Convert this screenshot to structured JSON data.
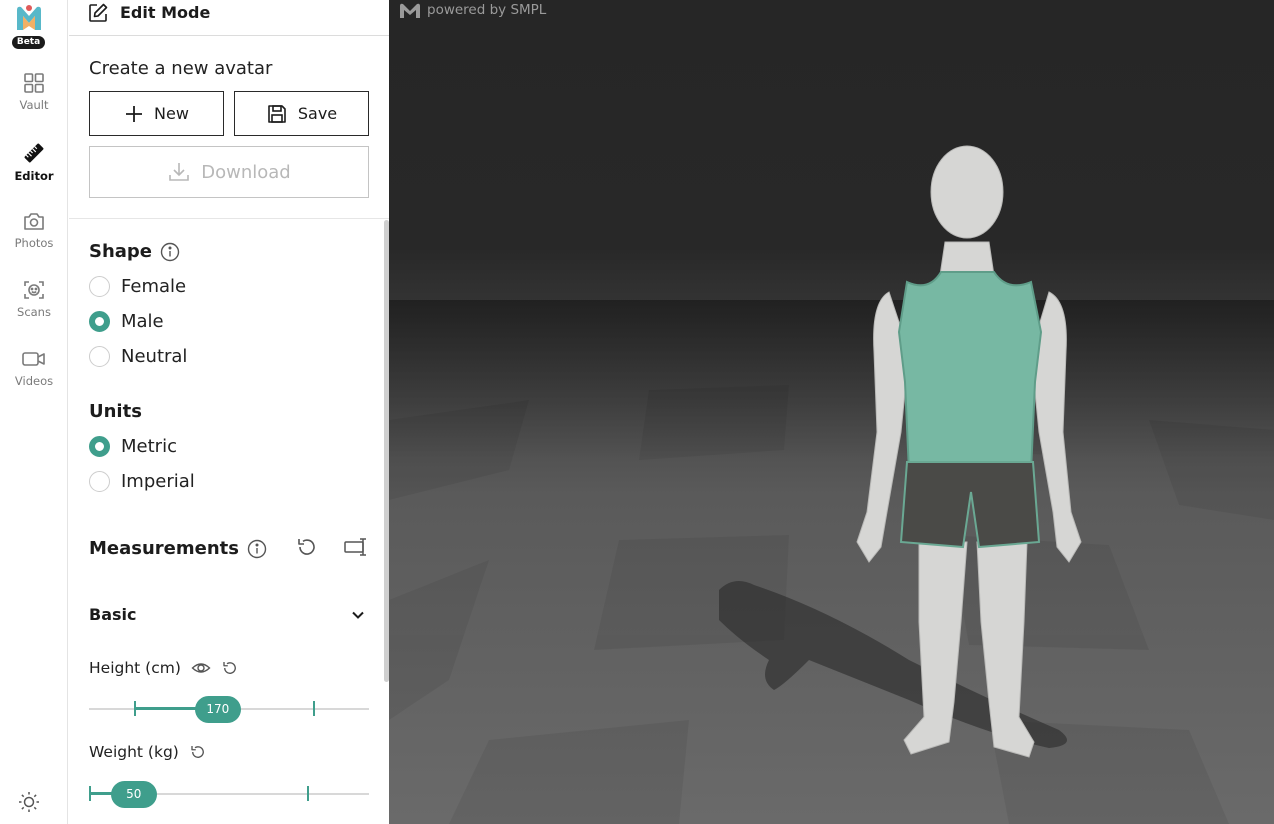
{
  "rail": {
    "badge": "Beta",
    "items": [
      {
        "label": "Vault",
        "icon": "grid-icon"
      },
      {
        "label": "Editor",
        "icon": "ruler-icon"
      },
      {
        "label": "Photos",
        "icon": "camera-icon"
      },
      {
        "label": "Scans",
        "icon": "face-scan-icon"
      },
      {
        "label": "Videos",
        "icon": "video-icon"
      }
    ],
    "active": "Editor",
    "theme_icon": "sun-icon"
  },
  "panel": {
    "header_title": "Edit Mode",
    "create_title": "Create a new avatar",
    "new_label": "New",
    "save_label": "Save",
    "download_label": "Download",
    "shape": {
      "title": "Shape",
      "options": [
        "Female",
        "Male",
        "Neutral"
      ],
      "selected": "Male"
    },
    "units": {
      "title": "Units",
      "options": [
        "Metric",
        "Imperial"
      ],
      "selected": "Metric"
    },
    "measurements": {
      "title": "Measurements",
      "group": "Basic",
      "height": {
        "label": "Height (cm)",
        "value": "170",
        "fraction": 0.46,
        "min_mark": 0.16,
        "max_mark": 0.8
      },
      "weight": {
        "label": "Weight (kg)",
        "value": "50",
        "fraction": 0.16,
        "min_mark": 0.0,
        "max_mark": 0.78
      }
    }
  },
  "viewport": {
    "powered_by": "powered by SMPL"
  },
  "colors": {
    "accent": "#3f9e8c",
    "shirt": "#77b8a3",
    "shorts": "#4a4a47",
    "skin": "#d6d6d4"
  }
}
